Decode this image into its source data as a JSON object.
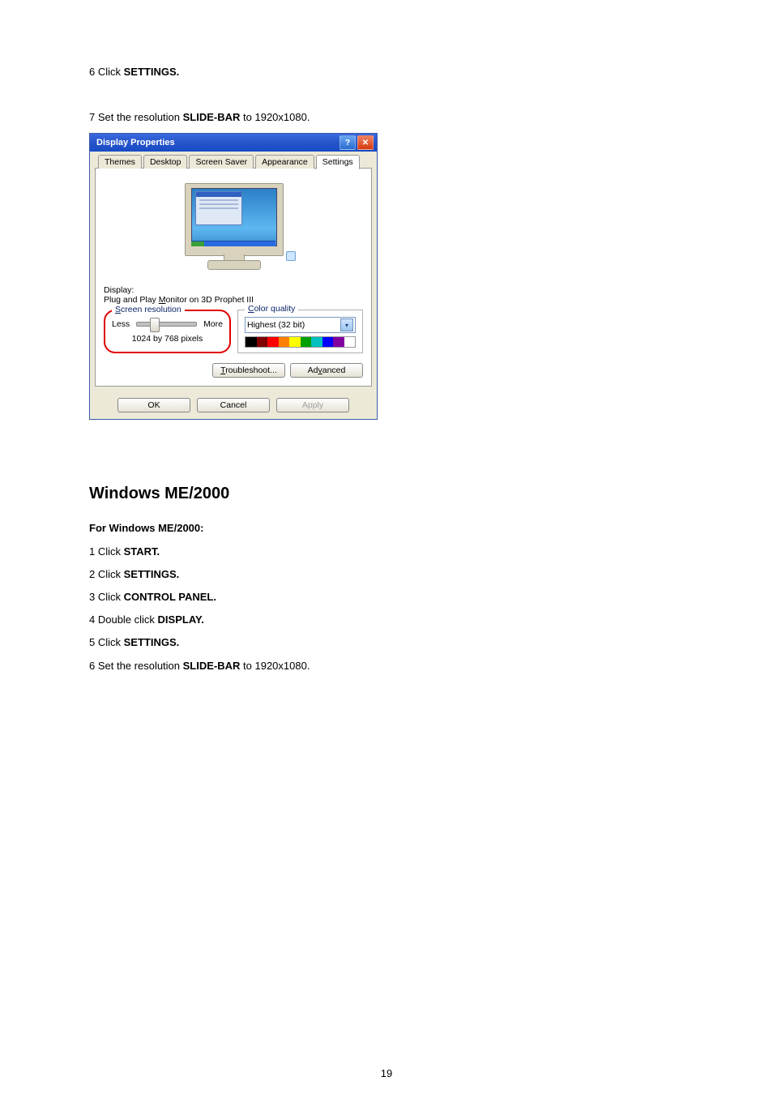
{
  "step6": {
    "prefix": "6 Click ",
    "bold": "SETTINGS."
  },
  "step7": {
    "prefix": "7 Set the resolution ",
    "bold": "SLIDE-BAR",
    "suffix": "  to 1920x1080."
  },
  "dialog": {
    "title": "Display Properties",
    "help_label": "?",
    "close_label": "✕",
    "tabs": {
      "themes": "Themes",
      "desktop": "Desktop",
      "screensaver": "Screen Saver",
      "appearance": "Appearance",
      "settings": "Settings"
    },
    "display_label": "Display:",
    "display_name_prefix": "Plug and Play ",
    "display_name_underlined": "M",
    "display_name_rest": "onitor on 3D Prophet III",
    "res_group": {
      "legend1": "S",
      "legend2": "creen resolution",
      "less": "Less",
      "more": "More",
      "value": "1024 by 768 pixels"
    },
    "cq_group": {
      "legend1": "C",
      "legend2": "olor quality",
      "selected": "Highest (32 bit)",
      "colors": [
        "#000000",
        "#800000",
        "#ff0000",
        "#ff8000",
        "#ffff00",
        "#00a000",
        "#00c0c0",
        "#0000ff",
        "#8000a0",
        "#ffffff"
      ]
    },
    "troubleshoot": {
      "u": "T",
      "rest": "roubleshoot..."
    },
    "advanced": {
      "pre": "Ad",
      "u": "v",
      "rest": "anced"
    },
    "ok": "OK",
    "cancel": "Cancel",
    "apply": "Apply"
  },
  "heading": "Windows ME/2000",
  "for_line": "For Windows ME/2000:",
  "me_steps": {
    "s1": {
      "prefix": "1 Click ",
      "bold": "START."
    },
    "s2": {
      "prefix": "2 Click ",
      "bold": "SETTINGS."
    },
    "s3": {
      "prefix": "3 Click ",
      "bold": "CONTROL PANEL."
    },
    "s4": {
      "prefix": "4 Double click ",
      "bold": "DISPLAY."
    },
    "s5": {
      "prefix": "5 Click ",
      "bold": "SETTINGS."
    },
    "s6": {
      "prefix": "6 Set the resolution ",
      "bold": "SLIDE-BAR",
      "suffix": "  to 1920x1080."
    }
  },
  "page_number": "19"
}
